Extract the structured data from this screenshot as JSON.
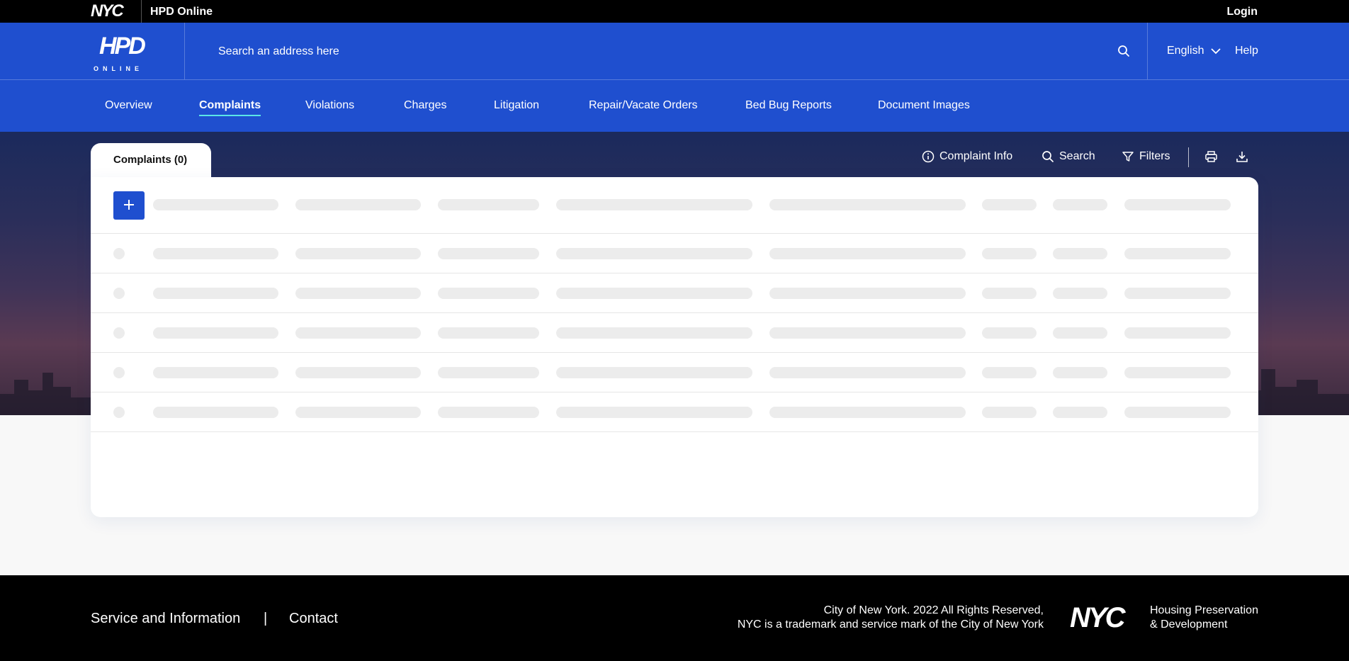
{
  "topbar": {
    "brand": "NYC",
    "app_name": "HPD Online",
    "login": "Login"
  },
  "header": {
    "logo_text": "HPD",
    "logo_subtext": "ONLINE",
    "search_placeholder": "Search an address here",
    "language": "English",
    "help": "Help"
  },
  "tabs": [
    {
      "label": "Overview",
      "active": false
    },
    {
      "label": "Complaints",
      "active": true
    },
    {
      "label": "Violations",
      "active": false
    },
    {
      "label": "Charges",
      "active": false
    },
    {
      "label": "Litigation",
      "active": false
    },
    {
      "label": "Repair/Vacate Orders",
      "active": false
    },
    {
      "label": "Bed Bug Reports",
      "active": false
    },
    {
      "label": "Document Images",
      "active": false
    }
  ],
  "panel": {
    "tab_label": "Complaints (0)",
    "tools": {
      "info": "Complaint Info",
      "search": "Search",
      "filters": "Filters"
    },
    "loading_rows": 5
  },
  "footer": {
    "service": "Service and Information",
    "separator": "|",
    "contact": "Contact",
    "copyright_line1": "City of New York. 2022 All Rights Reserved,",
    "copyright_line2": "NYC is a trademark and service mark of the City of New York",
    "brand": "NYC",
    "agency_line1": "Housing Preservation",
    "agency_line2": "& Development"
  },
  "colors": {
    "primary": "#1f4fcf",
    "accent_underline": "#5be6e6",
    "skeleton": "#ececec"
  }
}
